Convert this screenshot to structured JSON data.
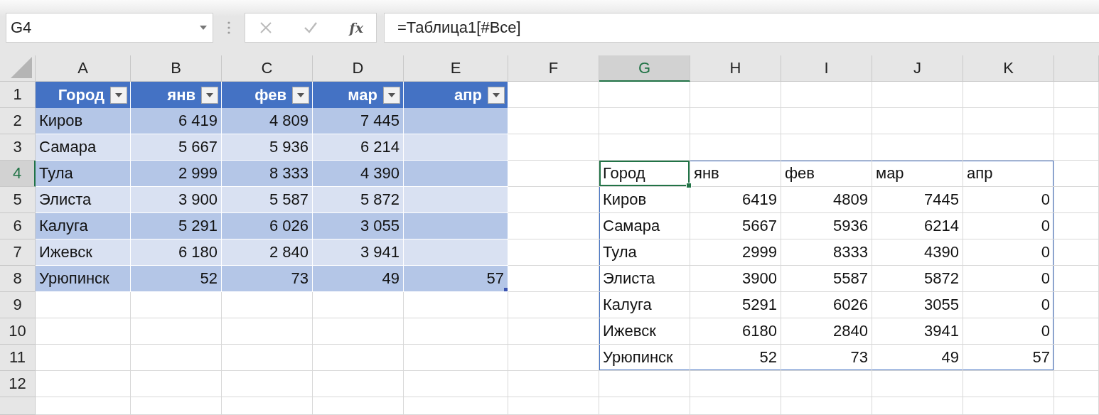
{
  "name_box": "G4",
  "formula_bar": {
    "function_label": "fx",
    "formula": "=Таблица1[#Все]"
  },
  "columns": [
    {
      "label": "A",
      "selected": false
    },
    {
      "label": "B",
      "selected": false
    },
    {
      "label": "C",
      "selected": false
    },
    {
      "label": "D",
      "selected": false
    },
    {
      "label": "E",
      "selected": false
    },
    {
      "label": "F",
      "selected": false
    },
    {
      "label": "G",
      "selected": true
    },
    {
      "label": "H",
      "selected": false
    },
    {
      "label": "I",
      "selected": false
    },
    {
      "label": "J",
      "selected": false
    },
    {
      "label": "K",
      "selected": false
    }
  ],
  "rows": [
    {
      "label": "1",
      "selected": false
    },
    {
      "label": "2",
      "selected": false
    },
    {
      "label": "3",
      "selected": false
    },
    {
      "label": "4",
      "selected": true
    },
    {
      "label": "5",
      "selected": false
    },
    {
      "label": "6",
      "selected": false
    },
    {
      "label": "7",
      "selected": false
    },
    {
      "label": "8",
      "selected": false
    },
    {
      "label": "9",
      "selected": false
    },
    {
      "label": "10",
      "selected": false
    },
    {
      "label": "11",
      "selected": false
    },
    {
      "label": "12",
      "selected": false
    }
  ],
  "table": {
    "header": [
      "Город",
      "янв",
      "фев",
      "мар",
      "апр"
    ],
    "rows": [
      [
        "Киров",
        "6 419",
        "4 809",
        "7 445"
      ],
      [
        "Самара",
        "5 667",
        "5 936",
        "6 214"
      ],
      [
        "Тула",
        "2 999",
        "8 333",
        "4 390"
      ],
      [
        "Элиста",
        "3 900",
        "5 587",
        "5 872"
      ],
      [
        "Калуга",
        "5 291",
        "6 026",
        "3 055"
      ],
      [
        "Ижевск",
        "6 180",
        "2 840",
        "3 941"
      ],
      [
        "Урюпинск",
        "52",
        "73",
        "49",
        "57"
      ]
    ]
  },
  "spill": {
    "rows": [
      [
        "Город",
        "янв",
        "фев",
        "мар",
        "апр"
      ],
      [
        "Киров",
        "6419",
        "4809",
        "7445",
        "0"
      ],
      [
        "Самара",
        "5667",
        "5936",
        "6214",
        "0"
      ],
      [
        "Тула",
        "2999",
        "8333",
        "4390",
        "0"
      ],
      [
        "Элиста",
        "3900",
        "5587",
        "5872",
        "0"
      ],
      [
        "Калуга",
        "5291",
        "6026",
        "3055",
        "0"
      ],
      [
        "Ижевск",
        "6180",
        "2840",
        "3941",
        "0"
      ],
      [
        "Урюпинск",
        "52",
        "73",
        "49",
        "57"
      ]
    ]
  }
}
